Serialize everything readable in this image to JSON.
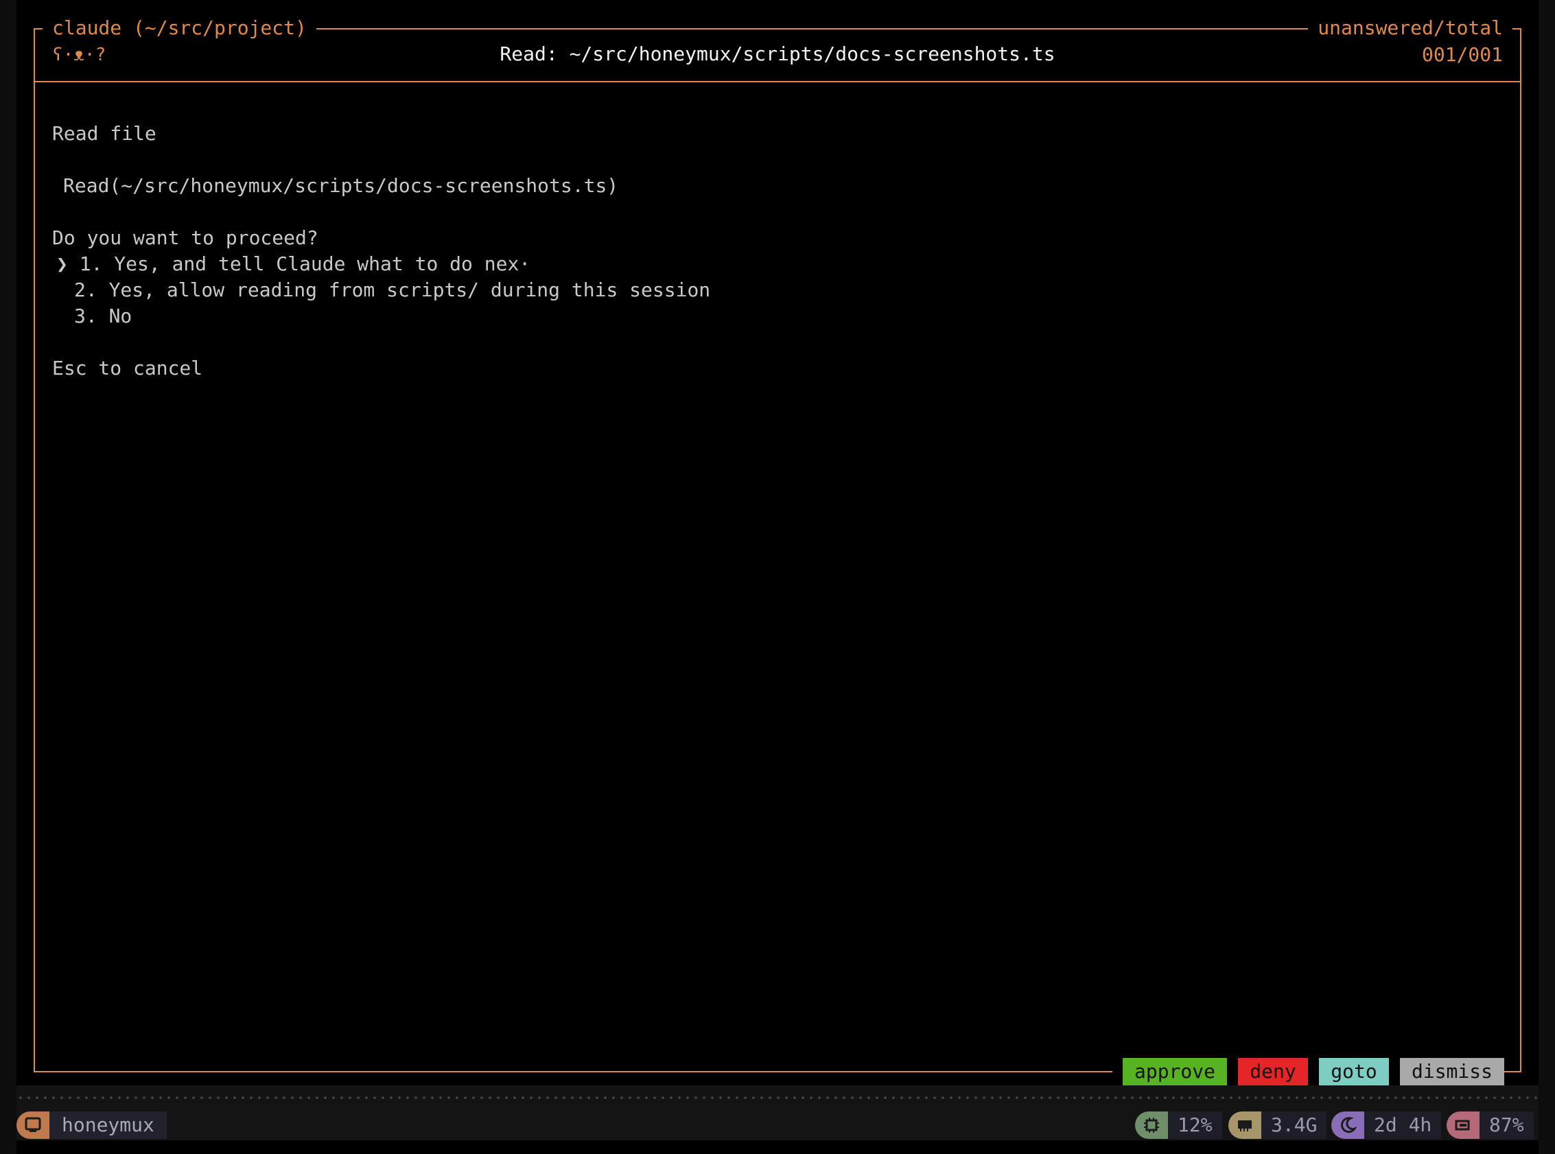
{
  "panel": {
    "title_left": "claude (~/src/project)",
    "title_right": "unanswered/total",
    "status_icons": "ʕ·ᴥ·?",
    "header_path": "Read: ~/src/honeymux/scripts/docs-screenshots.ts",
    "counter": "001/001"
  },
  "content": {
    "heading": "Read file",
    "call": "Read(~/src/honeymux/scripts/docs-screenshots.ts)",
    "question": "Do you want to proceed?",
    "options": [
      "❯ 1. Yes, and tell Claude what to do nex·",
      "2. Yes, allow reading from scripts/ during this session",
      "3. No"
    ],
    "hint": "Esc to cancel"
  },
  "actions": {
    "approve": "approve",
    "deny": "deny",
    "goto": "goto",
    "dismiss": "dismiss"
  },
  "statusbar": {
    "session_icon": "terminal-icon",
    "session_name": "honeymux",
    "cpu_icon": "cpu-icon",
    "cpu": "12%",
    "mem_icon": "memory-icon",
    "memory": "3.4G",
    "uptime_icon": "moon-icon",
    "uptime": "2d 4h",
    "battery_icon": "battery-icon",
    "battery": "87%"
  },
  "colors": {
    "accent": "#e0894a",
    "approve": "#58b322",
    "deny": "#e52526",
    "goto": "#7ecdc3",
    "dismiss": "#a9a9a9"
  }
}
